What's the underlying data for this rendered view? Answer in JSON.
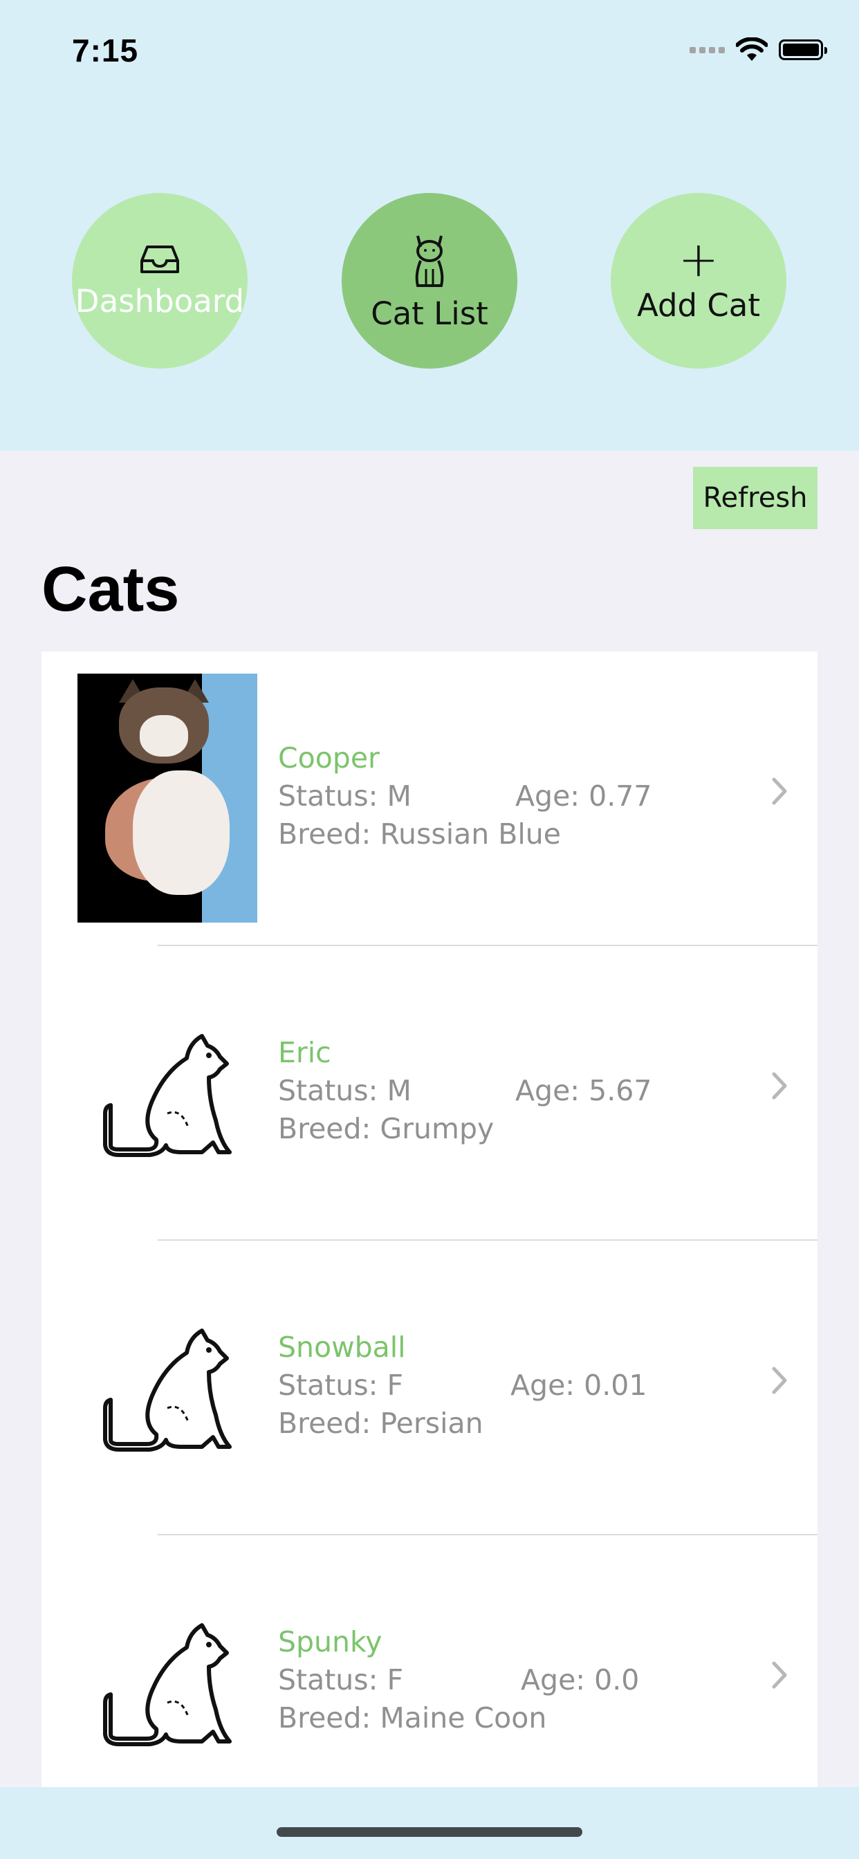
{
  "status_bar": {
    "time": "7:15"
  },
  "nav": {
    "dashboard": {
      "label": "Dashboard",
      "icon": "inbox-icon"
    },
    "cat_list": {
      "label": "Cat List",
      "icon": "cat-icon"
    },
    "add_cat": {
      "label": "Add Cat",
      "icon": "plus-icon",
      "glyph": "+"
    }
  },
  "refresh_label": "Refresh",
  "title": "Cats",
  "cats": [
    {
      "name": "Cooper",
      "status": "Status:  M",
      "age": "Age:  0.77",
      "breed": "Breed:  Russian  Blue",
      "image": "photo"
    },
    {
      "name": "Eric",
      "status": "Status:  M",
      "age": "Age:  5.67",
      "breed": "Breed:  Grumpy",
      "image": "cat-outline-icon"
    },
    {
      "name": "Snowball",
      "status": "Status:  F",
      "age": "Age:  0.01",
      "breed": "Breed:  Persian",
      "image": "cat-outline-icon"
    },
    {
      "name": "Spunky",
      "status": "Status:  F",
      "age": "Age:  0.0",
      "breed": "Breed:  Maine  Coon",
      "image": "cat-outline-icon"
    }
  ],
  "colors": {
    "header_bg": "#d8eff8",
    "nav_light": "#b7e9ad",
    "nav_active": "#8bc87c",
    "name_green": "#7cc36c",
    "detail_gray": "#909090",
    "page_bg": "#f1f0f6"
  }
}
